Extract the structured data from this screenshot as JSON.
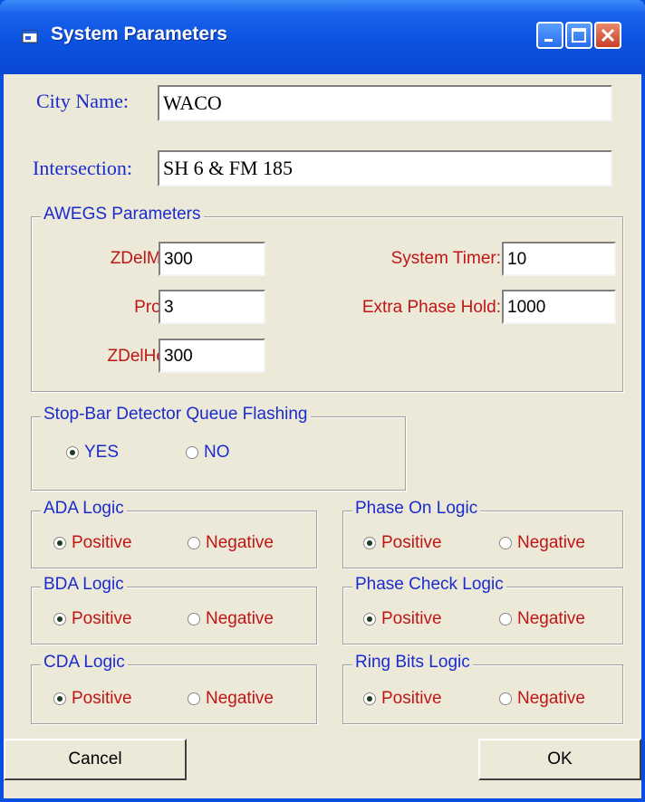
{
  "window": {
    "title": "System Parameters"
  },
  "city": {
    "label": "City Name:",
    "value": "WACO"
  },
  "intersection": {
    "label": "Intersection:",
    "value": "SH 6 & FM 185"
  },
  "awegs": {
    "title": "AWEGS Parameters",
    "zdelmax": {
      "label": "ZDelMax:",
      "value": "300"
    },
    "probt": {
      "label": "ProbT:",
      "value": "3"
    },
    "zdelhold": {
      "label": "ZDelHold:",
      "value": "300"
    },
    "system_timer": {
      "label": "System Timer:",
      "value": "10"
    },
    "extra_phase_hold": {
      "label": "Extra Phase Hold:",
      "value": "1000"
    }
  },
  "stopbar": {
    "title": "Stop-Bar Detector Queue Flashing",
    "yes": "YES",
    "no": "NO",
    "selected": "YES"
  },
  "logic_groups": {
    "ada": {
      "title": "ADA Logic",
      "positive": "Positive",
      "negative": "Negative",
      "selected": "Positive"
    },
    "bda": {
      "title": "BDA Logic",
      "positive": "Positive",
      "negative": "Negative",
      "selected": "Positive"
    },
    "cda": {
      "title": "CDA Logic",
      "positive": "Positive",
      "negative": "Negative",
      "selected": "Positive"
    },
    "phase_on": {
      "title": "Phase On Logic",
      "positive": "Positive",
      "negative": "Negative",
      "selected": "Positive"
    },
    "phase_check": {
      "title": "Phase Check Logic",
      "positive": "Positive",
      "negative": "Negative",
      "selected": "Positive"
    },
    "ring_bits": {
      "title": "Ring Bits Logic",
      "positive": "Positive",
      "negative": "Negative",
      "selected": "Positive"
    }
  },
  "buttons": {
    "cancel": "Cancel",
    "ok": "OK"
  },
  "colors": {
    "title_bar": "#0a4ee0",
    "dialog_bg": "#ece9d8",
    "label_blue": "#1a2bd0",
    "label_red": "#c01515"
  }
}
